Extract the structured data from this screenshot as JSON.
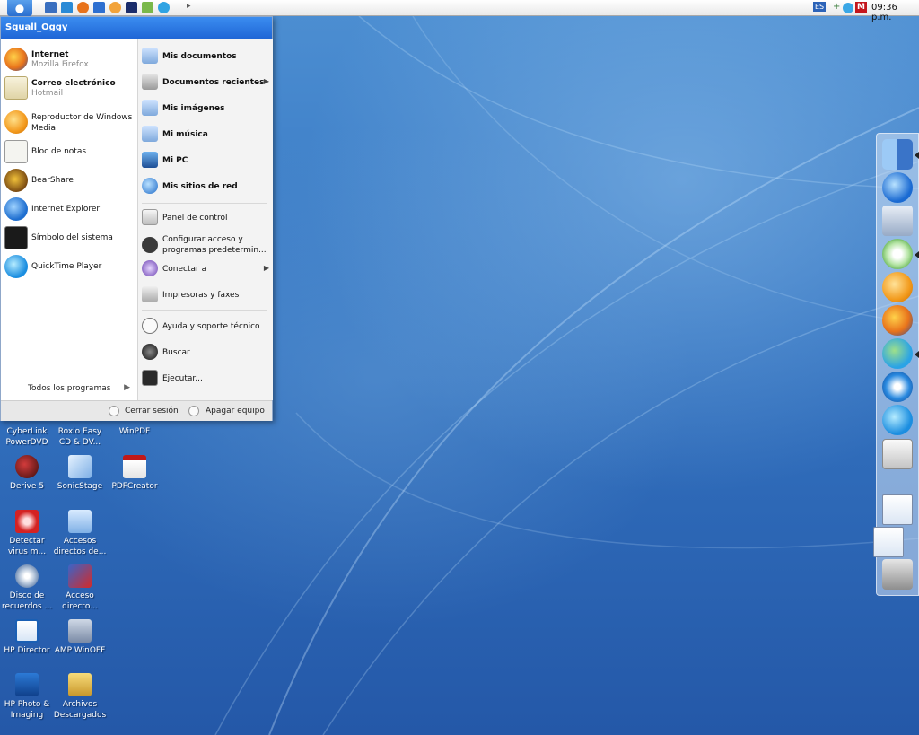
{
  "menubar": {
    "quicklaunch_icons": [
      "apple-icon",
      "ie-icon",
      "firefox-icon",
      "bearshare-icon",
      "mediaplayer-icon",
      "winamp-icon",
      "itunes-icon",
      "quicktime-icon"
    ],
    "language": "ES",
    "clock": "09:36 p.m."
  },
  "startmenu": {
    "user": "Squall_Oggy",
    "left_items": [
      {
        "title": "Internet",
        "subtitle": "Mozilla Firefox",
        "icon": "firefox-icon"
      },
      {
        "title": "Correo electrónico",
        "subtitle": "Hotmail",
        "icon": "mail-icon"
      },
      {
        "title": "Reproductor de Windows Media",
        "subtitle": "",
        "icon": "mediaplayer-icon"
      },
      {
        "title": "Bloc de notas",
        "subtitle": "",
        "icon": "notepad-icon"
      },
      {
        "title": "BearShare",
        "subtitle": "",
        "icon": "bearshare-icon"
      },
      {
        "title": "Internet Explorer",
        "subtitle": "",
        "icon": "ie-icon"
      },
      {
        "title": "Símbolo del sistema",
        "subtitle": "",
        "icon": "terminal-icon"
      },
      {
        "title": "QuickTime Player",
        "subtitle": "",
        "icon": "quicktime-icon"
      }
    ],
    "all_programs": "Todos los programas",
    "right_items": [
      {
        "label": "Mis documentos",
        "icon": "folder-icon",
        "submenu": false
      },
      {
        "label": "Documentos recientes",
        "icon": "recent-icon",
        "submenu": true
      },
      {
        "label": "Mis imágenes",
        "icon": "pictures-icon",
        "submenu": false
      },
      {
        "label": "Mi música",
        "icon": "music-icon",
        "submenu": false
      },
      {
        "label": "Mi PC",
        "icon": "computer-icon",
        "submenu": false
      },
      {
        "label": "Mis sitios de red",
        "icon": "network-icon",
        "submenu": false
      },
      {
        "label": "Panel de control",
        "icon": "control-panel-icon",
        "submenu": false
      },
      {
        "label": "Configurar acceso y programas predetermin...",
        "icon": "checkmark-icon",
        "submenu": false
      },
      {
        "label": "Conectar a",
        "icon": "connect-icon",
        "submenu": true
      },
      {
        "label": "Impresoras y faxes",
        "icon": "printer-icon",
        "submenu": false
      },
      {
        "label": "Ayuda y soporte técnico",
        "icon": "help-icon",
        "submenu": false
      },
      {
        "label": "Buscar",
        "icon": "search-icon",
        "submenu": false
      },
      {
        "label": "Ejecutar...",
        "icon": "run-icon",
        "submenu": false
      }
    ],
    "logoff": "Cerrar sesión",
    "shutdown": "Apagar equipo"
  },
  "desktop_icons": [
    {
      "label": "CyberLink PowerDVD",
      "icon": "powerdvd-icon"
    },
    {
      "label": "Roxio Easy CD & DV...",
      "icon": "roxio-icon"
    },
    {
      "label": "WinPDF",
      "icon": "winpdf-icon"
    },
    {
      "label": "Derive 5",
      "icon": "derive-icon"
    },
    {
      "label": "SonicStage",
      "icon": "sonicstage-icon"
    },
    {
      "label": "PDFCreator",
      "icon": "pdfcreator-icon"
    },
    {
      "label": "Detectar virus m...",
      "icon": "antivirus-icon"
    },
    {
      "label": "Accesos directos de...",
      "icon": "folder-icon"
    },
    {
      "label": "Disco de recuerdos ...",
      "icon": "disc-icon"
    },
    {
      "label": "Acceso directo...",
      "icon": "shortcut-icon"
    },
    {
      "label": "HP Director",
      "icon": "hp-director-icon"
    },
    {
      "label": "AMP WinOFF",
      "icon": "winoff-icon"
    },
    {
      "label": "HP Photo & Imaging",
      "icon": "hp-photo-icon"
    },
    {
      "label": "Archivos Descargados",
      "icon": "downloads-folder-icon"
    }
  ],
  "dock_items": [
    "finder-icon",
    "ie-icon",
    "mail-icon",
    "itunes-icon",
    "mediaplayer-icon",
    "firefox-icon",
    "messenger-icon",
    "quicktime-icon",
    "quicktime-icon",
    "control-panel-icon",
    "music-window-icon",
    "network-window-icon",
    "trash-icon"
  ]
}
